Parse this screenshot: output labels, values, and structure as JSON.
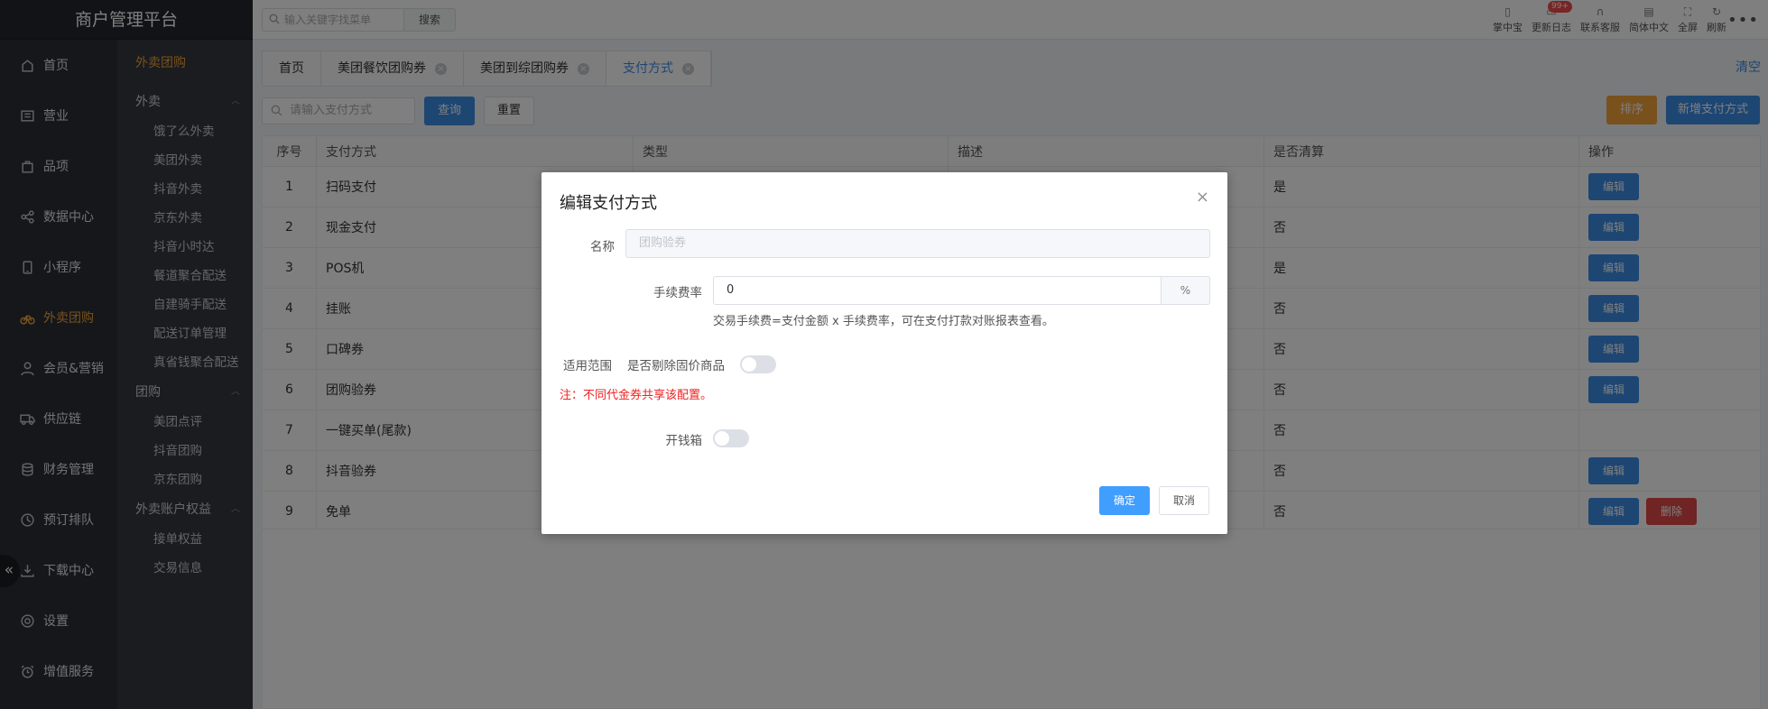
{
  "app": {
    "title": "商户管理平台"
  },
  "topbar": {
    "search_placeholder": "输入关键字找菜单",
    "search_button": "搜索",
    "tools": [
      {
        "icon": "phone-icon",
        "label": "掌中宝"
      },
      {
        "icon": "log-icon",
        "label": "更新日志",
        "badge": "99+"
      },
      {
        "icon": "headset-icon",
        "label": "联系客服"
      },
      {
        "icon": "language-icon",
        "label": "简体中文"
      },
      {
        "icon": "fullscreen-icon",
        "label": "全屏"
      },
      {
        "icon": "refresh-icon",
        "label": "刷新"
      }
    ],
    "more": "•••"
  },
  "sidebar": {
    "items": [
      {
        "icon": "home-icon",
        "label": "首页"
      },
      {
        "icon": "business-icon",
        "label": "营业"
      },
      {
        "icon": "product-icon",
        "label": "品项"
      },
      {
        "icon": "share-icon",
        "label": "数据中心"
      },
      {
        "icon": "mini-program-icon",
        "label": "小程序"
      },
      {
        "icon": "bike-icon",
        "label": "外卖团购",
        "active": true
      },
      {
        "icon": "member-icon",
        "label": "会员&营销"
      },
      {
        "icon": "truck-icon",
        "label": "供应链"
      },
      {
        "icon": "finance-icon",
        "label": "财务管理"
      },
      {
        "icon": "clock-icon",
        "label": "预订排队"
      },
      {
        "icon": "download-icon",
        "label": "下载中心"
      },
      {
        "icon": "gear-icon",
        "label": "设置"
      },
      {
        "icon": "alarm-icon",
        "label": "增值服务"
      }
    ],
    "collapse": "«"
  },
  "subnav": {
    "header": "外卖团购",
    "groups": [
      {
        "label": "外卖",
        "items": [
          "饿了么外卖",
          "美团外卖",
          "抖音外卖",
          "京东外卖",
          "抖音小时达",
          "餐道聚合配送",
          "自建骑手配送",
          "配送订单管理",
          "真省钱聚合配送"
        ]
      },
      {
        "label": "团购",
        "items": [
          "美团点评",
          "抖音团购",
          "京东团购"
        ]
      },
      {
        "label": "外卖账户权益",
        "items": [
          "接单权益",
          "交易信息"
        ]
      }
    ]
  },
  "tabs": [
    {
      "label": "首页",
      "closable": false
    },
    {
      "label": "美团餐饮团购券",
      "closable": true
    },
    {
      "label": "美团到综团购券",
      "closable": true
    },
    {
      "label": "支付方式",
      "closable": true,
      "active": true
    }
  ],
  "clear_all": "清空",
  "filter": {
    "placeholder": "请输入支付方式",
    "query": "查询",
    "reset": "重置",
    "sort": "排序",
    "add": "新增支付方式"
  },
  "table": {
    "columns": [
      "序号",
      "支付方式",
      "类型",
      "描述",
      "是否清算",
      "操作"
    ],
    "rows": [
      {
        "no": "1",
        "name": "扫码支付",
        "settle": "是",
        "ops": [
          "编辑"
        ]
      },
      {
        "no": "2",
        "name": "现金支付",
        "settle": "否",
        "ops": [
          "编辑"
        ]
      },
      {
        "no": "3",
        "name": "POS机",
        "settle": "是",
        "ops": [
          "编辑"
        ]
      },
      {
        "no": "4",
        "name": "挂账",
        "settle": "否",
        "ops": [
          "编辑"
        ]
      },
      {
        "no": "5",
        "name": "口碑券",
        "settle": "否",
        "ops": [
          "编辑"
        ]
      },
      {
        "no": "6",
        "name": "团购验券",
        "settle": "否",
        "ops": [
          "编辑"
        ]
      },
      {
        "no": "7",
        "name": "一键买单(尾款)",
        "settle": "否",
        "ops": []
      },
      {
        "no": "8",
        "name": "抖音验券",
        "settle": "否",
        "ops": [
          "编辑"
        ]
      },
      {
        "no": "9",
        "name": "免单",
        "settle": "否",
        "ops": [
          "编辑",
          "删除"
        ]
      }
    ]
  },
  "dialog": {
    "title": "编辑支付方式",
    "close": "×",
    "name_label": "名称",
    "name_value": "团购验券",
    "fee_label": "手续费率",
    "fee_value": "0",
    "fee_suffix": "%",
    "fee_hint": "交易手续费=支付金额 x 手续费率，可在支付打款对账报表查看。",
    "scope_label": "适用范围",
    "scope_option": "是否剔除固价商品",
    "scope_switch_on": false,
    "note": "注：不同代金券共享该配置。",
    "drawer_label": "开钱箱",
    "drawer_switch_on": false,
    "ok": "确定",
    "cancel": "取消"
  },
  "colors": {
    "accent": "#3b8de6",
    "active_nav": "#f0a23b",
    "danger": "#e04848",
    "note": "#f02020"
  }
}
